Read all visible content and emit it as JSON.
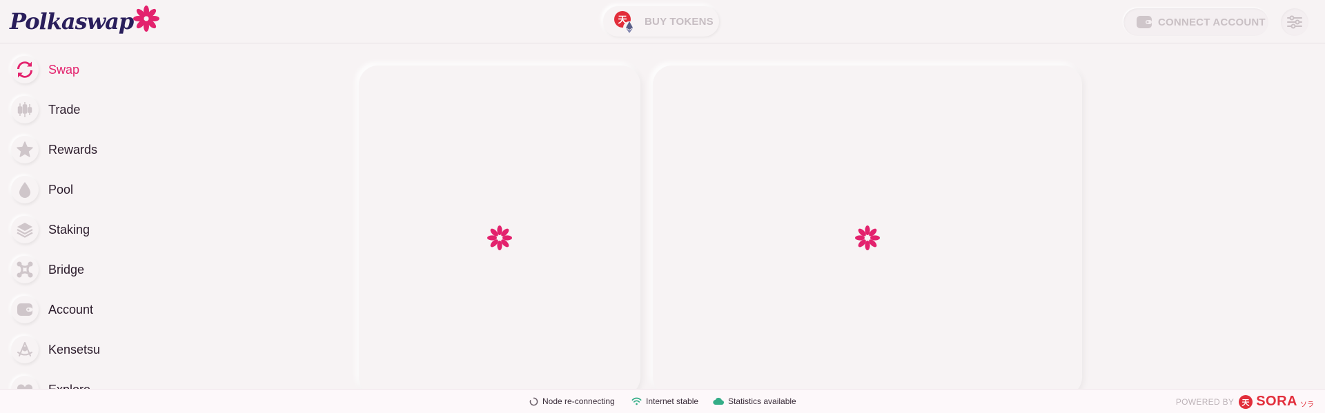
{
  "header": {
    "logo_text": "Polkaswap",
    "buy_tokens_label": "BUY TOKENS",
    "connect_label": "CONNECT ACCOUNT"
  },
  "sidebar": {
    "items": [
      {
        "label": "Swap",
        "icon": "swap-icon",
        "active": true
      },
      {
        "label": "Trade",
        "icon": "candlestick-icon",
        "active": false
      },
      {
        "label": "Rewards",
        "icon": "star-icon",
        "active": false
      },
      {
        "label": "Pool",
        "icon": "drop-icon",
        "active": false
      },
      {
        "label": "Staking",
        "icon": "layers-icon",
        "active": false
      },
      {
        "label": "Bridge",
        "icon": "bridge-icon",
        "active": false
      },
      {
        "label": "Account",
        "icon": "wallet-icon",
        "active": false
      },
      {
        "label": "Kensetsu",
        "icon": "kensetsu-icon",
        "active": false
      },
      {
        "label": "Explore",
        "icon": "explore-icon",
        "active": false
      }
    ]
  },
  "footer": {
    "node_status": "Node re-connecting",
    "internet_status": "Internet stable",
    "statistics_status": "Statistics available",
    "powered_by": "POWERED BY",
    "brand": "SORA",
    "brand_kana": "ソラ"
  },
  "colors": {
    "accent": "#e3226d",
    "background": "#f7f3f4",
    "status_green": "#34ad87",
    "sora_red": "#e22e3b"
  }
}
